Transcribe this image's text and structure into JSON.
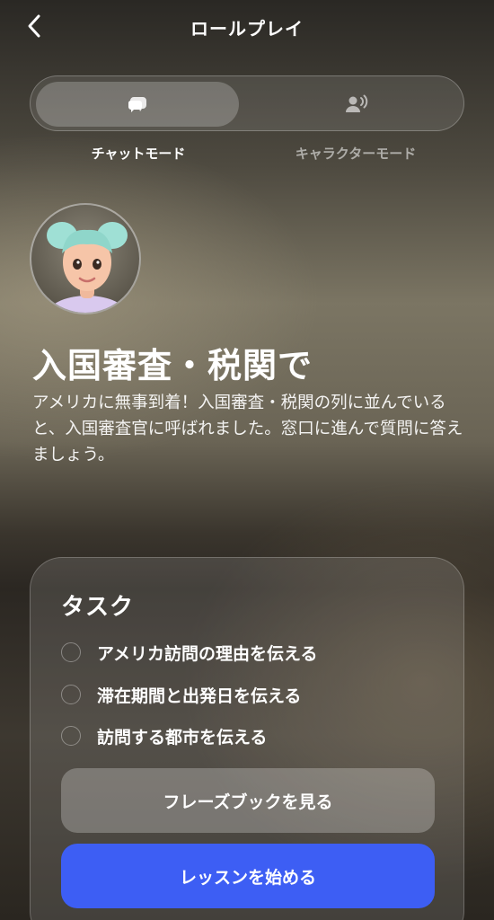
{
  "header": {
    "title": "ロールプレイ"
  },
  "mode_toggle": {
    "options": [
      {
        "label": "チャットモード",
        "icon": "chat-bubbles-icon",
        "selected": true
      },
      {
        "label": "キャラクターモード",
        "icon": "speaking-person-icon",
        "selected": false
      }
    ]
  },
  "scenario": {
    "title": "入国審査・税関で",
    "description": "アメリカに無事到着！入国審査・税関の列に並んでいると、入国審査官に呼ばれました。窓口に進んで質問に答えましょう。"
  },
  "tasks": {
    "heading": "タスク",
    "items": [
      {
        "label": "アメリカ訪問の理由を伝える",
        "done": false
      },
      {
        "label": "滞在期間と出発日を伝える",
        "done": false
      },
      {
        "label": "訪問する都市を伝える",
        "done": false
      }
    ]
  },
  "buttons": {
    "phrasebook": "フレーズブックを見る",
    "start": "レッスンを始める"
  },
  "colors": {
    "primary": "#3d5ef4"
  }
}
